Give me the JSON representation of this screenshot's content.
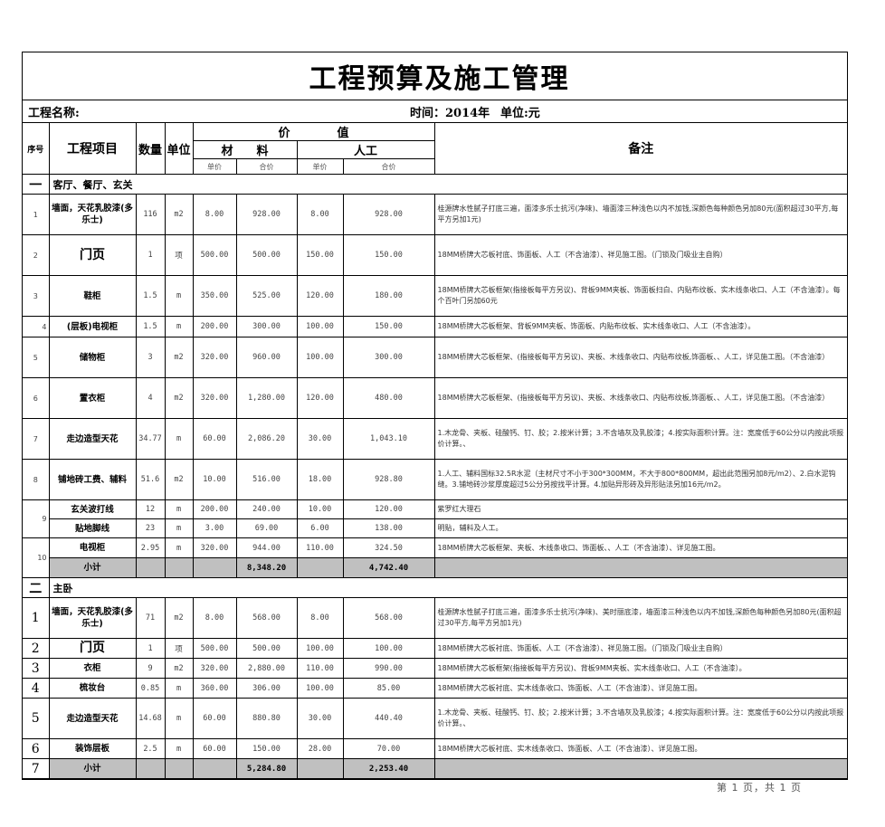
{
  "header": {
    "title": "工程预算及施工管理",
    "project_name_label": "工程名称:",
    "time_label": "时间：2014年",
    "unit_label": "单位:元"
  },
  "columns": {
    "seq": "序号",
    "item": "工程项目",
    "qty": "数量",
    "unit": "单位",
    "value": "价　　　　值",
    "material": "材　　料",
    "labor": "人工",
    "unit_price": "单价",
    "total_price": "合价",
    "notes": "备注"
  },
  "sections": [
    {
      "number": "一",
      "title": "客厅、餐厅、玄关",
      "rows": [
        {
          "idx": "1",
          "name": "墙面，天花乳胶漆(多乐士)",
          "qty": "116",
          "unit": "m2",
          "mat_unit": "8.00",
          "mat_total": "928.00",
          "lab_unit": "8.00",
          "lab_total": "928.00",
          "note": "桂源牌水性腻子打底三遍，面漆多乐士抗污(净味)、墙面漆三种浅色以内不加钱,深颜色每种颜色另加80元(面积超过30平方,每平方另加1元)"
        },
        {
          "idx": "2",
          "name": "门页",
          "qty": "1",
          "unit": "项",
          "mat_unit": "500.00",
          "mat_total": "500.00",
          "lab_unit": "150.00",
          "lab_total": "150.00",
          "note": "18MM桥牌大芯板衬底、饰面板、人工（不含油漆）、祥见施工图。（门锁及门吸业主自购）"
        },
        {
          "idx": "3",
          "name": "鞋柜",
          "qty": "1.5",
          "unit": "m",
          "mat_unit": "350.00",
          "mat_total": "525.00",
          "lab_unit": "120.00",
          "lab_total": "180.00",
          "note": "18MM桥牌大芯板框架(指接板每平方另议)、背板9MM夹板、饰面板扫白、内贴布纹板、实木线条收口、人工（不含油漆）。每个百叶门另加60元"
        },
        {
          "idx": "4",
          "name": "(层板)电视柜",
          "qty": "1.5",
          "unit": "m",
          "mat_unit": "200.00",
          "mat_total": "300.00",
          "lab_unit": "100.00",
          "lab_total": "150.00",
          "note": "18MM桥牌大芯板框架、背板9MM夹板、饰面板、内贴布纹板、实木线条收口、人工（不含油漆）。"
        },
        {
          "idx": "5",
          "name": "储物柜",
          "qty": "3",
          "unit": "m2",
          "mat_unit": "320.00",
          "mat_total": "960.00",
          "lab_unit": "100.00",
          "lab_total": "300.00",
          "note": "18MM桥牌大芯板框架、(指接板每平方另议)、夹板、木线条收口、内贴布纹板,饰面板、、人工，详见施工图。（不含油漆）"
        },
        {
          "idx": "6",
          "name": "置衣柜",
          "qty": "4",
          "unit": "m2",
          "mat_unit": "320.00",
          "mat_total": "1,280.00",
          "lab_unit": "120.00",
          "lab_total": "480.00",
          "note": "18MM桥牌大芯板框架、(指接板每平方另议)、夹板、木线条收口、内贴布纹板,饰面板、、人工，详见施工图。（不含油漆）"
        },
        {
          "idx": "7",
          "name": "走边造型天花",
          "qty": "34.77",
          "unit": "m",
          "mat_unit": "60.00",
          "mat_total": "2,086.20",
          "lab_unit": "30.00",
          "lab_total": "1,043.10",
          "note": "1.木龙骨、夹板、硅酸钙、钉、胶；2.按米计算；3.不含墙灰及乳胶漆；4.按实际面积计算。注：宽度低于60公分以内按此项报价计算。、"
        },
        {
          "idx": "8",
          "name": "铺地砖工费、辅料",
          "qty": "51.6",
          "unit": "m2",
          "mat_unit": "10.00",
          "mat_total": "516.00",
          "lab_unit": "18.00",
          "lab_total": "928.80",
          "note": "1.人工、辅料国标32.5R水泥（主材尺寸不小于300*300MM，不大于800*800MM，超出此范围另加8元/m2）、2.白水泥钩缝。3.铺地砖沙浆厚度超过5公分另按找平计算。4.加贴异形砖及异形贴法另加16元/m2。"
        },
        {
          "idx": "9",
          "name": "玄关波打线",
          "qty": "12",
          "unit": "m",
          "mat_unit": "200.00",
          "mat_total": "240.00",
          "lab_unit": "10.00",
          "lab_total": "120.00",
          "note": "紫罗红大理石"
        },
        {
          "idx": "",
          "name": "贴地脚线",
          "qty": "23",
          "unit": "m",
          "mat_unit": "3.00",
          "mat_total": "69.00",
          "lab_unit": "6.00",
          "lab_total": "138.00",
          "note": "明贴，辅料及人工。"
        },
        {
          "idx": "10",
          "name": "电视柜",
          "qty": "2.95",
          "unit": "m",
          "mat_unit": "320.00",
          "mat_total": "944.00",
          "lab_unit": "110.00",
          "lab_total": "324.50",
          "note": "18MM桥牌大芯板框架、夹板、木线条收口、饰面板、、人工（不含油漆）、详见施工图。"
        }
      ],
      "subtotal": {
        "label": "小计",
        "mat_total": "8,348.20",
        "lab_total": "4,742.40"
      }
    },
    {
      "number": "二",
      "title": "主卧",
      "rows": [
        {
          "idx": "1",
          "name": "墙面，天花乳胶漆(多乐士)",
          "qty": "71",
          "unit": "m2",
          "mat_unit": "8.00",
          "mat_total": "568.00",
          "lab_unit": "8.00",
          "lab_total": "568.00",
          "note": "桂源牌水性腻子打底三遍，面漆多乐士抗污(净味)、美时丽底漆，墙面漆三种浅色以内不加钱,深颜色每种颜色另加80元(面积超过30平方,每平方另加1元)"
        },
        {
          "idx": "2",
          "name": "门页",
          "qty": "1",
          "unit": "项",
          "mat_unit": "500.00",
          "mat_total": "500.00",
          "lab_unit": "100.00",
          "lab_total": "100.00",
          "note": "18MM桥牌大芯板衬底、饰面板、人工（不含油漆）、祥见施工图。（门锁及门吸业主自购）"
        },
        {
          "idx": "3",
          "name": "衣柜",
          "qty": "9",
          "unit": "m2",
          "mat_unit": "320.00",
          "mat_total": "2,880.00",
          "lab_unit": "110.00",
          "lab_total": "990.00",
          "note": "18MM桥牌大芯板框架(指接板每平方另议)、背板9MM夹板、实木线条收口、人工（不含油漆）。"
        },
        {
          "idx": "4",
          "name": "梳妆台",
          "qty": "0.85",
          "unit": "m",
          "mat_unit": "360.00",
          "mat_total": "306.00",
          "lab_unit": "100.00",
          "lab_total": "85.00",
          "note": "18MM桥牌大芯板衬底、实木线条收口、饰面板、人工（不含油漆）、详见施工图。"
        },
        {
          "idx": "5",
          "name": "走边造型天花",
          "qty": "14.68",
          "unit": "m",
          "mat_unit": "60.00",
          "mat_total": "880.80",
          "lab_unit": "30.00",
          "lab_total": "440.40",
          "note": "1.木龙骨、夹板、硅酸钙、钉、胶；2.按米计算；3.不含墙灰及乳胶漆；4.按实际面积计算。注：宽度低于60公分以内按此项报价计算。、"
        },
        {
          "idx": "6",
          "name": "装饰层板",
          "qty": "2.5",
          "unit": "m",
          "mat_unit": "60.00",
          "mat_total": "150.00",
          "lab_unit": "28.00",
          "lab_total": "70.00",
          "note": "18MM桥牌大芯板衬底、实木线条收口、饰面板、人工（不含油漆）、详见施工图。"
        }
      ],
      "subtotal": {
        "idx": "7",
        "label": "小计",
        "mat_total": "5,284.80",
        "lab_total": "2,253.40"
      }
    }
  ],
  "footer": {
    "page_label": "第 1 页，共 1 页"
  },
  "colors": {
    "subtotal_bg": "#c0c0c0",
    "border": "#000000"
  }
}
